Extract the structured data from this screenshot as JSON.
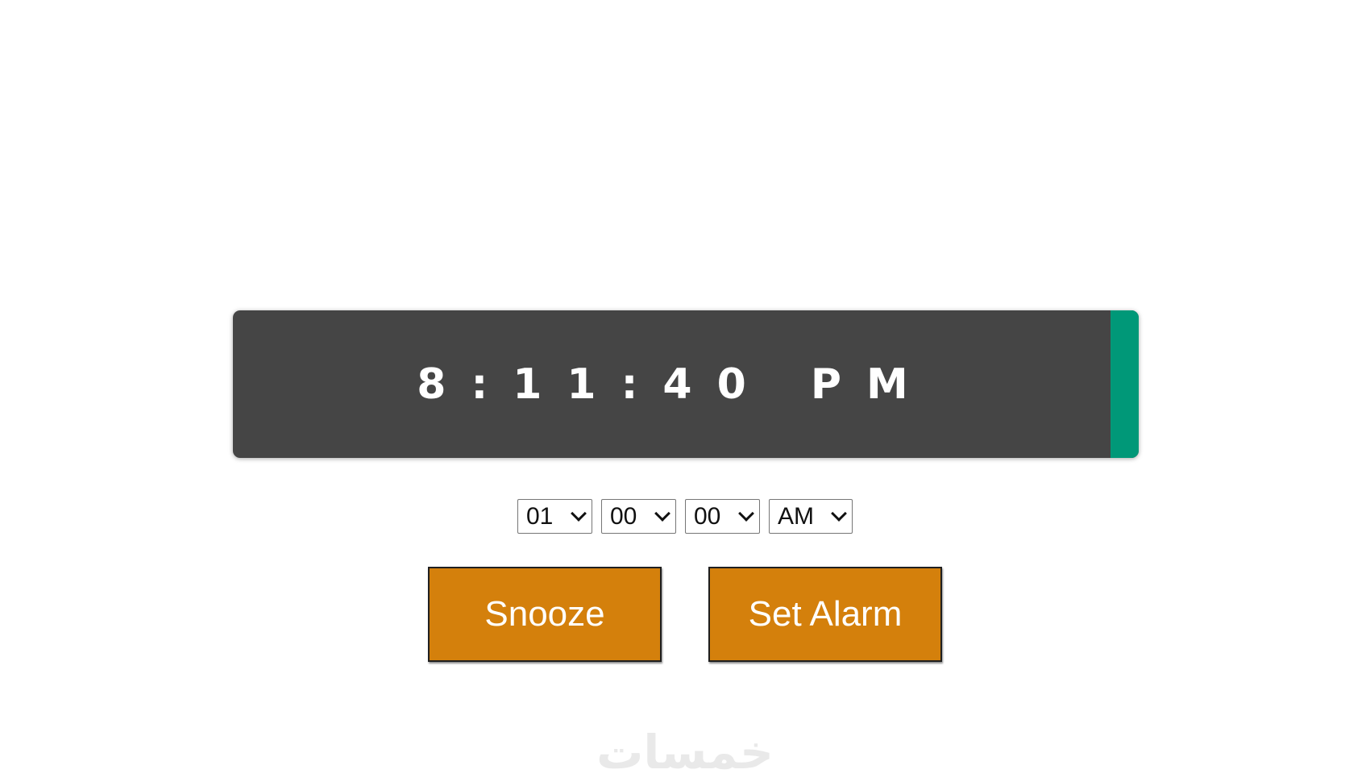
{
  "clock": {
    "time_display": "8:11:40 PM",
    "accent_color": "#009878",
    "panel_color": "#454545"
  },
  "alarm_selects": {
    "hour": "01",
    "minute": "00",
    "second": "00",
    "period": "AM"
  },
  "buttons": {
    "snooze_label": "Snooze",
    "set_alarm_label": "Set Alarm",
    "color": "#d4800c"
  },
  "watermark": {
    "text": "خمسات"
  }
}
